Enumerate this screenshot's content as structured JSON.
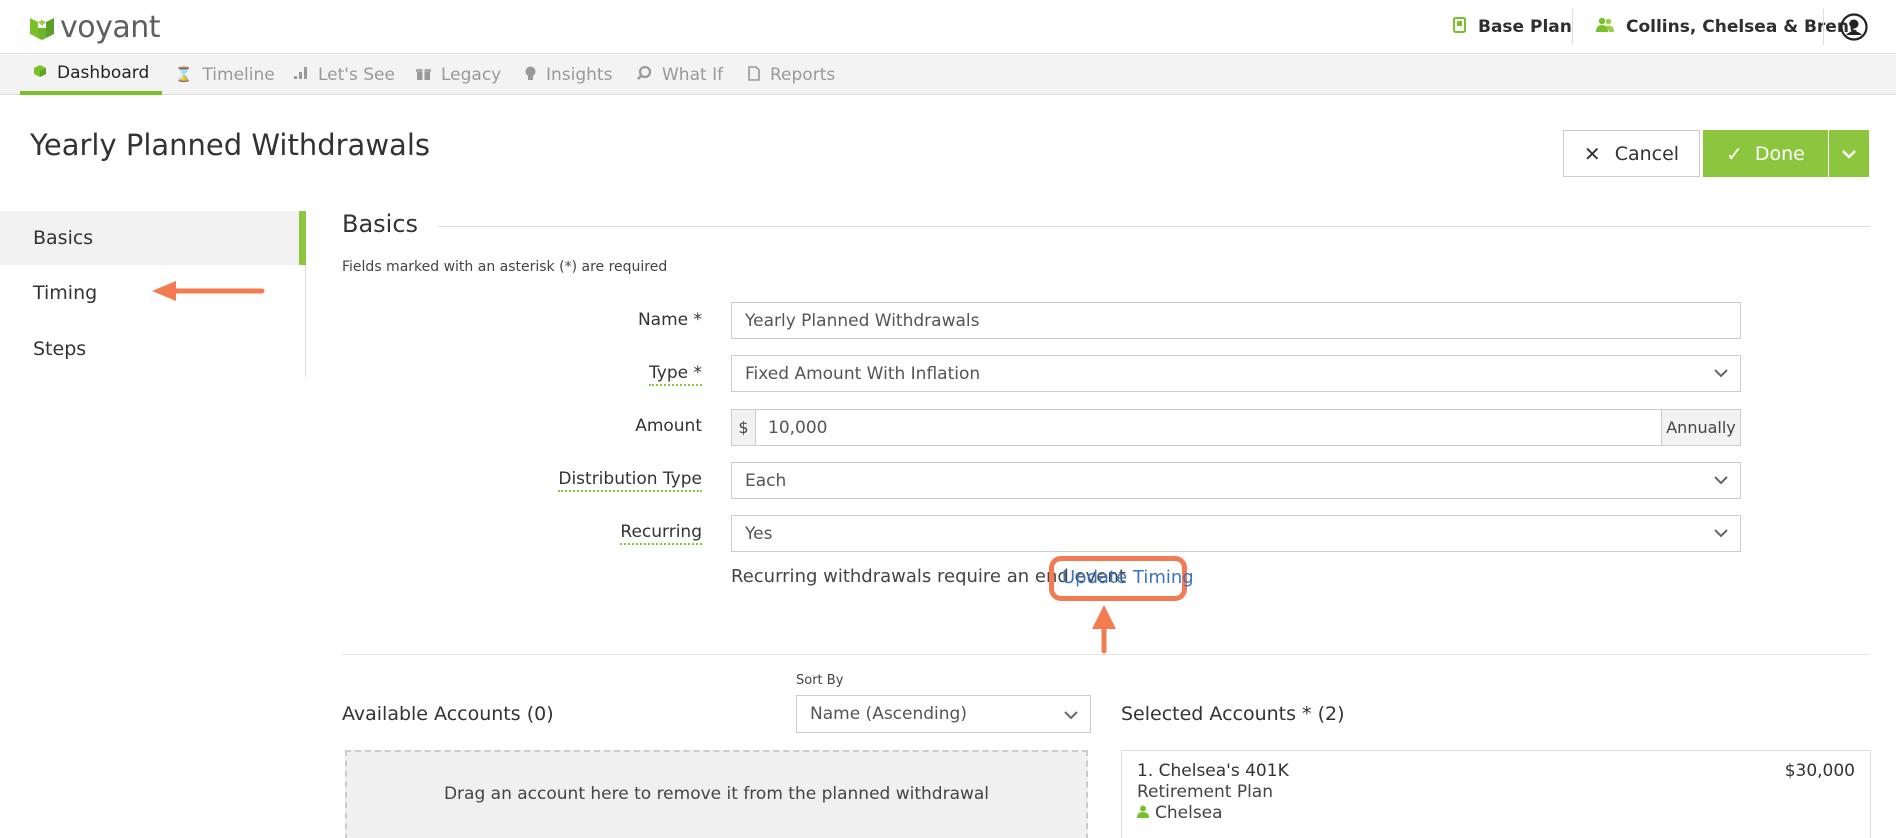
{
  "header": {
    "logo_text": "voyant",
    "plan_label": "Base Plan",
    "clients_label": "Collins, Chelsea & Brent"
  },
  "nav": {
    "items": [
      {
        "label": "Dashboard",
        "icon": "cube-icon"
      },
      {
        "label": "Timeline",
        "icon": "hourglass-icon"
      },
      {
        "label": "Let's See",
        "icon": "bar-chart-icon"
      },
      {
        "label": "Legacy",
        "icon": "gift-icon"
      },
      {
        "label": "Insights",
        "icon": "lightbulb-icon"
      },
      {
        "label": "What If",
        "icon": "magnify-icon"
      },
      {
        "label": "Reports",
        "icon": "document-icon"
      }
    ],
    "active": "Dashboard"
  },
  "page": {
    "title": "Yearly Planned Withdrawals",
    "cancel_label": "Cancel",
    "done_label": "Done"
  },
  "sidebar": {
    "items": [
      {
        "label": "Basics"
      },
      {
        "label": "Timing"
      },
      {
        "label": "Steps"
      }
    ],
    "active": "Basics"
  },
  "section": {
    "title": "Basics",
    "required_note": "Fields marked with an asterisk (*) are required"
  },
  "form": {
    "name_label": "Name *",
    "name_value": "Yearly Planned Withdrawals",
    "type_label": "Type *",
    "type_value": "Fixed Amount With Inflation",
    "amount_label": "Amount",
    "amount_prefix": "$",
    "amount_value": "10,000",
    "amount_suffix": "Annually",
    "distribution_label": "Distribution Type",
    "distribution_value": "Each",
    "recurring_label": "Recurring",
    "recurring_value": "Yes",
    "recurring_note": "Recurring withdrawals require an end event",
    "update_timing_link": "Update Timing"
  },
  "accounts": {
    "available_title": "Available Accounts (0)",
    "sort_by_label": "Sort By",
    "sort_by_value": "Name (Ascending)",
    "selected_title": "Selected Accounts * (2)",
    "dropzone_text": "Drag an account here to remove it from the planned withdrawal",
    "selected": [
      {
        "name": "1. Chelsea's 401K",
        "amount": "$30,000",
        "type": "Retirement Plan",
        "owner": "Chelsea"
      }
    ]
  },
  "colors": {
    "accent": "#8cc63f",
    "link": "#3a74c2",
    "annotation": "#f27b52"
  }
}
